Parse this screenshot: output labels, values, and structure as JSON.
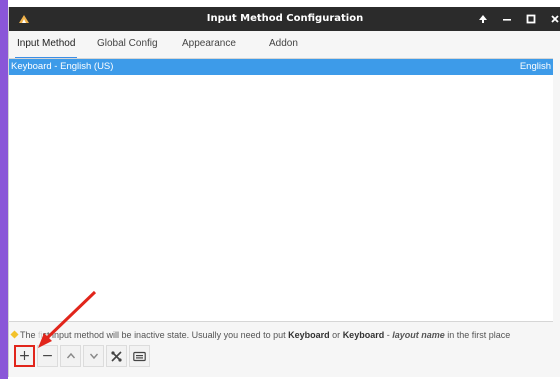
{
  "window": {
    "title": "Input Method Configuration",
    "controls": [
      "▲",
      "–",
      "▫",
      "×"
    ]
  },
  "tabs": [
    {
      "label": "Input Method",
      "active": true
    },
    {
      "label": "Global Config",
      "active": false
    },
    {
      "label": "Appearance",
      "active": false
    },
    {
      "label": "Addon",
      "active": false
    }
  ],
  "input_methods": [
    {
      "name": "Keyboard - English (US)",
      "language": "English",
      "selected": true
    }
  ],
  "hint": {
    "prefix": "The ",
    "faded": "fi",
    "text1": "st input method will be inactive state. Usually you need to put ",
    "kw1": "Keyboard",
    "text2": " or ",
    "kw2": "Keyboard",
    "text3": " - ",
    "kw3": "layout name",
    "text4": " in the first place"
  },
  "toolbar": {
    "add": "+",
    "remove": "−",
    "up": "^",
    "down": "v"
  },
  "colors": {
    "accent": "#3d9be9",
    "titlebar": "#2b2b2b",
    "highlight": "#e1251b",
    "side_accent": "#8a56d8"
  }
}
